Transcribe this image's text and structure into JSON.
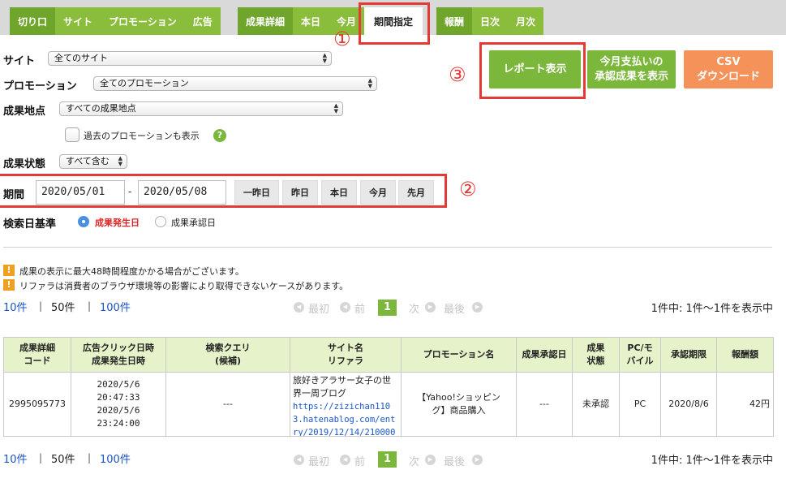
{
  "tabs": {
    "group1": [
      "切り口",
      "サイト",
      "プロモーション",
      "広告"
    ],
    "group2": [
      "成果詳細",
      "本日",
      "今月",
      "期間指定"
    ],
    "group3": [
      "報酬",
      "日次",
      "月次"
    ]
  },
  "annotations": {
    "one": "①",
    "two": "②",
    "three": "③"
  },
  "filters": {
    "site_label": "サイト",
    "site_value": "全てのサイト",
    "promotion_label": "プロモーション",
    "promotion_value": "全てのプロモーション",
    "point_label": "成果地点",
    "point_value": "すべての成果地点",
    "past_checkbox_label": "過去のプロモーションも表示",
    "help_symbol": "?",
    "status_label": "成果状態",
    "status_value": "すべて含む"
  },
  "period": {
    "label": "期間",
    "start": "2020/05/01",
    "separator": "-",
    "end": "2020/05/08",
    "quick": [
      "一昨日",
      "昨日",
      "本日",
      "今月",
      "先月"
    ]
  },
  "basis": {
    "label": "検索日基準",
    "option1": "成果発生日",
    "option2": "成果承認日"
  },
  "actions": {
    "report_line1": "レポート表示",
    "monthly_line1": "今月支払いの",
    "monthly_line2": "承認成果を表示",
    "csv_line1": "CSV",
    "csv_line2": "ダウンロード"
  },
  "notices": [
    "成果の表示に最大48時間程度かかる場合がございます。",
    "リファラは消費者のブラウザ環境等の影響により取得できないケースがあります。"
  ],
  "warn_symbol": "!",
  "pagination": {
    "per_page": [
      "10件",
      "50件",
      "100件"
    ],
    "bar": "|",
    "first": "最初",
    "prev": "前",
    "current": "1",
    "next": "次",
    "last": "最後",
    "count_text": "1件中: 1件〜1件を表示中"
  },
  "table": {
    "headers": [
      [
        "成果詳細",
        "コード"
      ],
      [
        "広告クリック日時",
        "成果発生日時"
      ],
      [
        "検索クエリ",
        "(候補)"
      ],
      [
        "サイト名",
        "リファラ"
      ],
      [
        "プロモーション名",
        ""
      ],
      [
        "成果承認日",
        ""
      ],
      [
        "成果",
        "状態"
      ],
      [
        "PC/モ",
        "バイル"
      ],
      [
        "承認期限",
        ""
      ],
      [
        "報酬額",
        ""
      ]
    ],
    "row": {
      "code": "2995095773",
      "click_datetime": "2020/5/6 20:47:33",
      "result_datetime": "2020/5/6 23:24:00",
      "query": "---",
      "site_name": "旅好きアラサー女子の世界一周ブログ",
      "referrer": "https://zizichan1103.hatenablog.com/entry/2019/12/14/210000",
      "promotion_line1": "【Yahoo!ショッピン",
      "promotion_line2": "グ】商品購入",
      "approval_date": "---",
      "status": "未承認",
      "device": "PC",
      "deadline": "2020/8/6",
      "reward": "42円"
    }
  }
}
